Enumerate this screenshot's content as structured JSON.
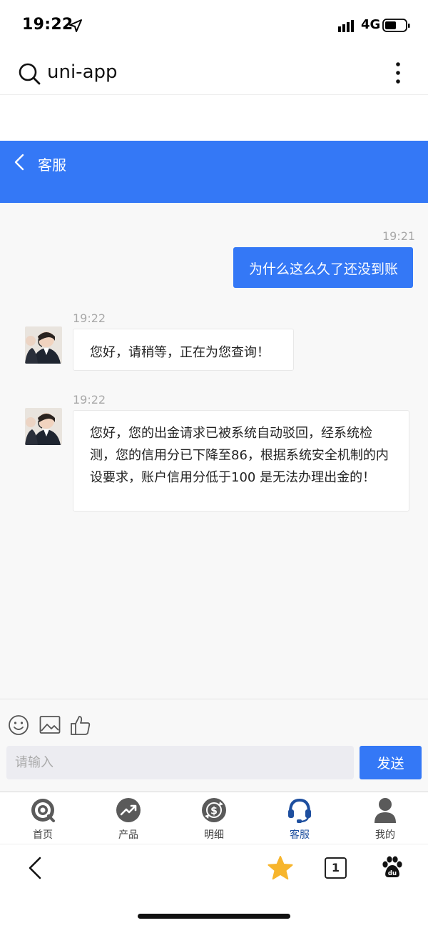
{
  "status_bar": {
    "time": "19:22",
    "network": "4G"
  },
  "browser": {
    "title": "uni-app",
    "tab_count": "1"
  },
  "header": {
    "title": "客服"
  },
  "chat": {
    "messages": [
      {
        "time": "19:21",
        "text": "为什么这么久了还没到账",
        "from": "user"
      },
      {
        "time": "19:22",
        "text": "您好，请稍等，正在为您查询！",
        "from": "agent"
      },
      {
        "time": "19:22",
        "text": "您好，您的出金请求已被系统自动驳回，经系统检测，您的信用分已下降至86，根据系统安全机制的内设要求，账户信用分低于100 是无法办理出金的！",
        "from": "agent"
      }
    ]
  },
  "input": {
    "placeholder": "请输入",
    "send_label": "发送"
  },
  "tabs": [
    {
      "label": "首页",
      "icon": "home-target-icon"
    },
    {
      "label": "产品",
      "icon": "trend-chart-icon"
    },
    {
      "label": "明细",
      "icon": "dollar-cycle-icon"
    },
    {
      "label": "客服",
      "icon": "headset-icon",
      "active": true
    },
    {
      "label": "我的",
      "icon": "user-icon"
    }
  ],
  "colors": {
    "accent": "#3478f6",
    "active_tab": "#1e4f9f",
    "chat_bg": "#f8f8f8"
  }
}
